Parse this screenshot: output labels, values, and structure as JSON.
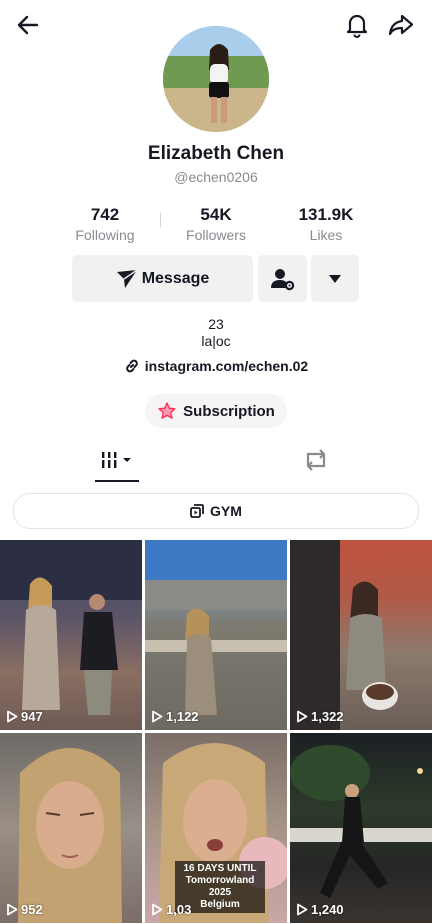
{
  "profile": {
    "name": "Elizabeth Chen",
    "handle": "@echen0206"
  },
  "stats": [
    {
      "value": "742",
      "label": "Following"
    },
    {
      "value": "54K",
      "label": "Followers"
    },
    {
      "value": "131.9K",
      "label": "Likes"
    }
  ],
  "actions": {
    "message_label": "Message"
  },
  "bio": {
    "line1": "23",
    "line2": "la|oc",
    "link": "instagram.com/echen.02"
  },
  "subscription": {
    "label": "Subscription"
  },
  "playlist": {
    "label": "GYM"
  },
  "videos": [
    {
      "views": "947"
    },
    {
      "views": "1,122"
    },
    {
      "views": "1,322"
    },
    {
      "views": "952"
    },
    {
      "views": "1,03",
      "caption_line1": "16 DAYS UNTIL",
      "caption_line2": "Tomorrowland 2025",
      "caption_line3": "Belgium"
    },
    {
      "views": "1,240"
    }
  ],
  "colors": {
    "accent": "#fe2c55",
    "button_bg": "#f1f1f2",
    "text_primary": "#161823",
    "text_secondary": "#8a8b91"
  }
}
